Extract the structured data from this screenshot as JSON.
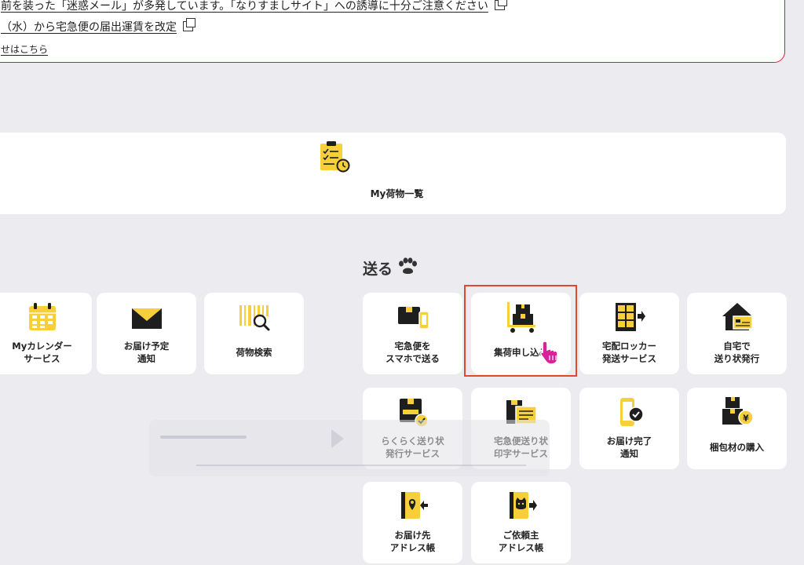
{
  "notices": {
    "line1": "前を装った「迷惑メール」が多発しています。「なりすましサイト」への誘導に十分ご注意ください",
    "line2": "（水）から宅急便の届出運賃を改定",
    "line3": "せはこちら"
  },
  "my_packages": {
    "label": "My荷物一覧",
    "icon": "clipboard-clock-icon"
  },
  "send_section": {
    "title": "送る",
    "icon": "paw-icon"
  },
  "tiles": [
    {
      "id": "calendar",
      "label": "Myカレンダー\nサービス",
      "icon": "calendar-icon"
    },
    {
      "id": "delivery-notice",
      "label": "お届け予定\n通知",
      "icon": "envelope-icon"
    },
    {
      "id": "package-search",
      "label": "荷物検索",
      "icon": "barcode-search-icon"
    },
    {
      "id": "smartphone-send",
      "label": "宅急便を\nスマホで送る",
      "icon": "box-phone-icon"
    },
    {
      "id": "pickup-request",
      "label": "集荷申し込み",
      "icon": "handcart-icon"
    },
    {
      "id": "locker-send",
      "label": "宅配ロッカー\n発送サービス",
      "icon": "locker-icon"
    },
    {
      "id": "home-label",
      "label": "自宅で\n送り状発行",
      "icon": "house-label-icon"
    },
    {
      "id": "easy-label",
      "label": "らくらく送り状\n発行サービス",
      "icon": "box-check-icon"
    },
    {
      "id": "label-print",
      "label": "宅急便送り状\n印字サービス",
      "icon": "label-print-icon"
    },
    {
      "id": "delivered-notice",
      "label": "お届け完了\n通知",
      "icon": "phone-check-icon"
    },
    {
      "id": "packing-materials",
      "label": "梱包材の購入",
      "icon": "boxes-yen-icon"
    },
    {
      "id": "recipient-book",
      "label": "お届け先\nアドレス帳",
      "icon": "address-book-in-icon"
    },
    {
      "id": "sender-book",
      "label": "ご依頼主\nアドレス帳",
      "icon": "address-book-out-icon"
    }
  ],
  "colors": {
    "accent_yellow": "#f6cf3a",
    "icon_dark": "#1e1e1e",
    "notice_border": "#c8282d",
    "highlight_border": "#e0492e",
    "cursor_magenta": "#d9229a",
    "background": "#ebebf0"
  }
}
